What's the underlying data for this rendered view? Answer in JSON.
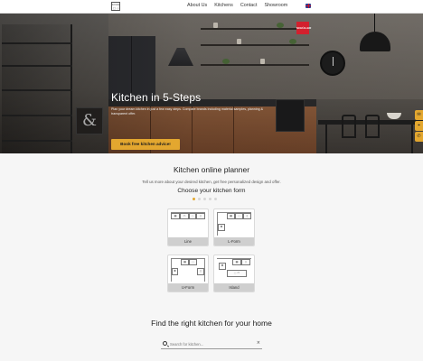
{
  "header": {
    "logo_glyphs": [
      "bm",
      "ks",
      "□",
      "◇"
    ],
    "nav": [
      "About Us",
      "Kitchens",
      "Contact",
      "Showroom"
    ],
    "language_icon": "uk-flag-icon"
  },
  "hero": {
    "title": "Kitchen in 5-Steps",
    "subtitle": "Plan your dream kitchen in just a few easy steps. Compare brands including material samples, planning & transparent offer.",
    "cta": "Book free kitchen advice!",
    "brand_badge": "SCHÜLLER",
    "side_tabs": [
      {
        "icon": "mail-icon",
        "glyph": "✉"
      },
      {
        "icon": "location-pin-icon",
        "glyph": "⌖"
      },
      {
        "icon": "phone-icon",
        "glyph": "✆"
      }
    ]
  },
  "planner": {
    "title": "Kitchen online planner",
    "description": "Tell us more about your desired kitchen, get free personalized design and offer.",
    "form_title": "Choose your kitchen form",
    "steps": 5,
    "active_step": 1,
    "options": [
      {
        "label": "Line"
      },
      {
        "label": "L-Form"
      },
      {
        "label": "U-Form"
      },
      {
        "label": "Island"
      }
    ]
  },
  "finder": {
    "title": "Find the right kitchen for your home",
    "search_placeholder": "Search for kitchen...",
    "clear_icon": "close-icon"
  },
  "colors": {
    "accent": "#e3a72f",
    "brand_red": "#d3202e"
  }
}
